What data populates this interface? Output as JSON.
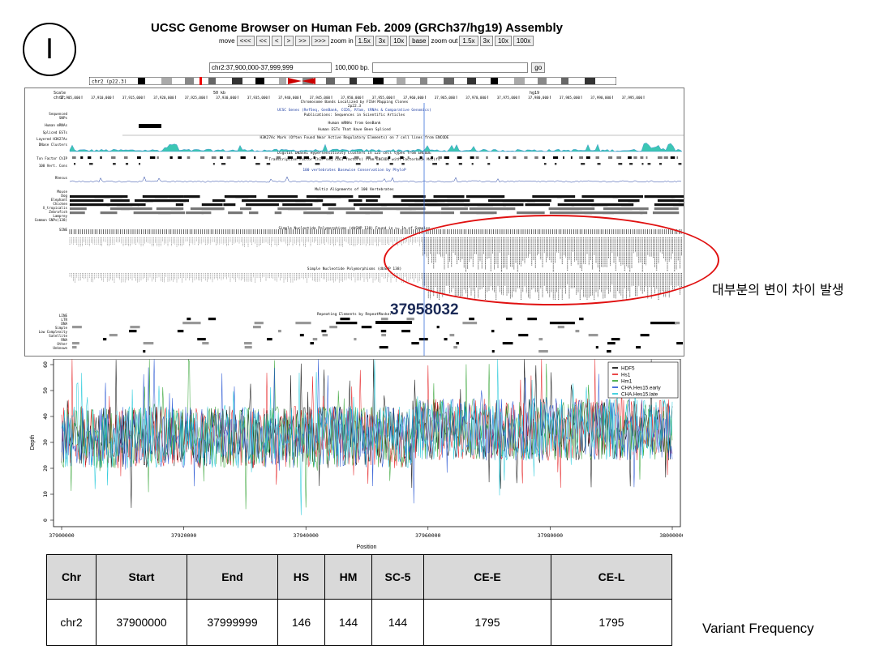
{
  "panel_label": "I",
  "browser": {
    "title": "UCSC Genome Browser on Human Feb. 2009 (GRCh37/hg19) Assembly",
    "move_label": "move",
    "move_buttons": [
      "<<<",
      "<<",
      "<",
      ">",
      ">>",
      ">>>"
    ],
    "zoom_in_label": "zoom in",
    "zoom_in_buttons": [
      "1.5x",
      "3x",
      "10x",
      "base"
    ],
    "zoom_out_label": "zoom out",
    "zoom_out_buttons": [
      "1.5x",
      "3x",
      "10x",
      "100x"
    ],
    "position": "chr2:37,900,000-37,999,999",
    "size_label": "100,000 bp.",
    "go_label": "go",
    "ideogram_label": "chr2 (p22.3)",
    "scale_label": "Scale",
    "chr_label": "chr2:",
    "scale_value": "50 kb",
    "assembly": "hg19",
    "ruler_ticks": [
      "37,905,000",
      "37,910,000",
      "37,915,000",
      "37,920,000",
      "37,925,000",
      "37,930,000",
      "37,935,000",
      "37,940,000",
      "37,945,000",
      "37,950,000",
      "37,955,000",
      "37,960,000",
      "37,965,000",
      "37,970,000",
      "37,975,000",
      "37,980,000",
      "37,985,000",
      "37,990,000",
      "37,995,000"
    ],
    "track_headers": [
      "Chromosome Bands Localized by FISH Mapping Clones",
      "2p22.3",
      "UCSC Genes (RefSeq, GenBank, CCDS, Rfam, tRNAs & Comparative Genomics)",
      "Publications: Sequences in Scientific Articles",
      "Human mRNAs from GenBank",
      "Human ESTs That Have Been Spliced",
      "H3K27Ac Mark (Often Found Near Active Regulatory Elements) on 7 cell lines from ENCODE",
      "Digital DNaseI Hypersensitivity Clusters in 125 cell types from ENCODE",
      "Transcription Factor ChIP-seq (161 factors) from ENCODE with Factorbook Motifs",
      "100 vertebrates Basewise Conservation by PhyloP",
      "Multiz Alignments of 100 Vertebrates",
      "Simple Nucleotide Polymorphisms (dbSNP 138) Found in >= 1% of Samples",
      "Simple Nucleotide Polymorphisms (dbSNP 138)",
      "Repeating Elements by RepeatMasker"
    ],
    "left_labels": [
      "Sequenced",
      "SNPs",
      "Human mRNAs",
      "Spliced ESTs",
      "Layered H3K27Ac",
      "DNase Clusters",
      "Txn Factor ChIP",
      "100 Vert. Cons",
      "Rhesus",
      "Mouse",
      "Dog",
      "Elephant",
      "Chicken",
      "X_tropicalis",
      "Zebrafish",
      "Lamprey",
      "Common SNPs(138)",
      "SINE",
      "LINE",
      "LTR",
      "DNA",
      "Simple",
      "Low Complexity",
      "Satellite",
      "RNA",
      "Other",
      "Unknown"
    ]
  },
  "annotations": {
    "korean_note": "대부분의 변이 차이 발생",
    "position_callout": "37958032",
    "ellipse_color": "#e01010",
    "vertical_marker_color": "#3b6fd8"
  },
  "chart_data": {
    "type": "line",
    "xlabel": "Position",
    "ylabel": "Depth",
    "xlim": [
      37900000,
      38000000
    ],
    "ylim": [
      0,
      60
    ],
    "x_ticks": [
      37900000,
      37920000,
      37940000,
      37960000,
      37980000,
      38000000
    ],
    "y_ticks": [
      0,
      10,
      20,
      30,
      40,
      50,
      60
    ],
    "legend_position": "top-right",
    "series": [
      {
        "name": "HDF5",
        "color": "#000000",
        "x_range": [
          37900000,
          38000000
        ],
        "y_typical": [
          22,
          45
        ],
        "y_range": [
          0,
          62
        ]
      },
      {
        "name": "Hs1",
        "color": "#e41a1c",
        "x_range": [
          37900000,
          38000000
        ],
        "y_typical": [
          22,
          45
        ],
        "y_range": [
          0,
          62
        ]
      },
      {
        "name": "Hm1",
        "color": "#2ca02c",
        "x_range": [
          37900000,
          38000000
        ],
        "y_typical": [
          22,
          45
        ],
        "y_range": [
          0,
          62
        ]
      },
      {
        "name": "CHA.Hes15.early",
        "color": "#1f4fd1",
        "x_range": [
          37900000,
          38000000
        ],
        "y_typical": [
          22,
          45
        ],
        "y_range": [
          0,
          62
        ]
      },
      {
        "name": "CHA.Hes15.late",
        "color": "#19c6d8",
        "x_range": [
          37900000,
          38000000
        ],
        "y_typical": [
          22,
          45
        ],
        "y_range": [
          0,
          62
        ]
      }
    ]
  },
  "table": {
    "headers": [
      "Chr",
      "Start",
      "End",
      "HS",
      "HM",
      "SC-5",
      "CE-E",
      "CE-L"
    ],
    "rows": [
      [
        "chr2",
        "37900000",
        "37999999",
        "146",
        "144",
        "144",
        "1795",
        "1795"
      ]
    ]
  },
  "variant_frequency_label": "Variant Frequency"
}
